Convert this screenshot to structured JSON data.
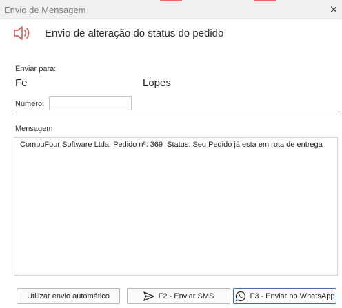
{
  "window": {
    "title": "Envio de Mensagem",
    "close_glyph": "✕"
  },
  "header": {
    "icon": "speaker-icon",
    "title": "Envio de alteração do status do pedido"
  },
  "recipient": {
    "label": "Enviar para:",
    "first_name": "Fe",
    "last_name": "Lopes"
  },
  "phone": {
    "label": "Número:",
    "value": ""
  },
  "message": {
    "label": "Mensagem",
    "text": "CompuFour Software Ltda  Pedido nº: 369  Status: Seu Pedido já esta em rota de entrega"
  },
  "buttons": {
    "auto_label": "Utilizar envio automático",
    "sms_label": "F2 - Enviar SMS",
    "sms_icon": "send-icon",
    "whatsapp_label": "F3 - Enviar no WhatsApp",
    "whatsapp_icon": "whatsapp-icon"
  },
  "colors": {
    "speaker_icon": "#d9534f",
    "focus_border": "#3b6fb6"
  }
}
